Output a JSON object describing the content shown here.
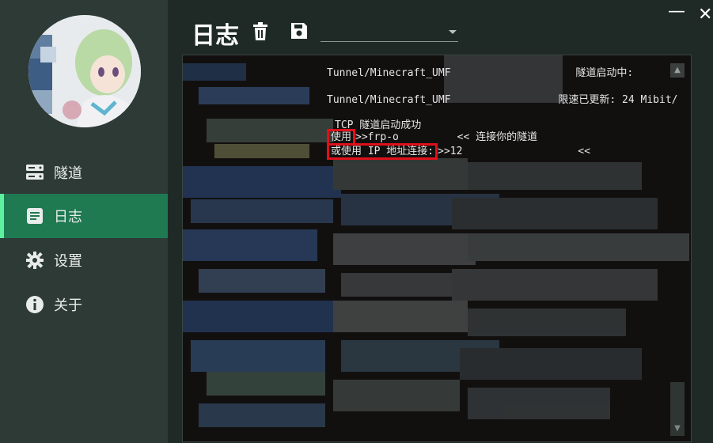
{
  "sidebar": {
    "items": [
      {
        "label": "隧道",
        "icon": "server-icon"
      },
      {
        "label": "日志",
        "icon": "log-icon",
        "active": true
      },
      {
        "label": "设置",
        "icon": "gear-icon"
      },
      {
        "label": "关于",
        "icon": "info-icon"
      }
    ]
  },
  "header": {
    "title": "日志",
    "delete_icon": "trash-icon",
    "save_icon": "save-icon",
    "dropdown_value": ""
  },
  "window": {
    "minimize": "—",
    "close": "✕"
  },
  "log": {
    "lines": [
      {
        "text": "Tunnel/Minecraft_UMF",
        "suffix": "隧道启动中:"
      },
      {
        "text": "Tunnel/Minecraft_UMF",
        "suffix": "限速已更新: 24 Mibit/"
      },
      {
        "text": "TCP 隧道启动成功"
      },
      {
        "hl": "使用",
        "text": ">>frp-o",
        "suffix": "<< 连接你的隧道"
      },
      {
        "hl": "或使用 IP 地址连接:",
        "text": ">>12",
        "suffix": "<<"
      }
    ]
  },
  "colors": {
    "sidebar_bg": "#2e3a36",
    "active_bg": "#1f7a52",
    "active_accent": "#5cf0a0",
    "log_bg": "#12100f",
    "highlight_border": "#e0101a"
  }
}
